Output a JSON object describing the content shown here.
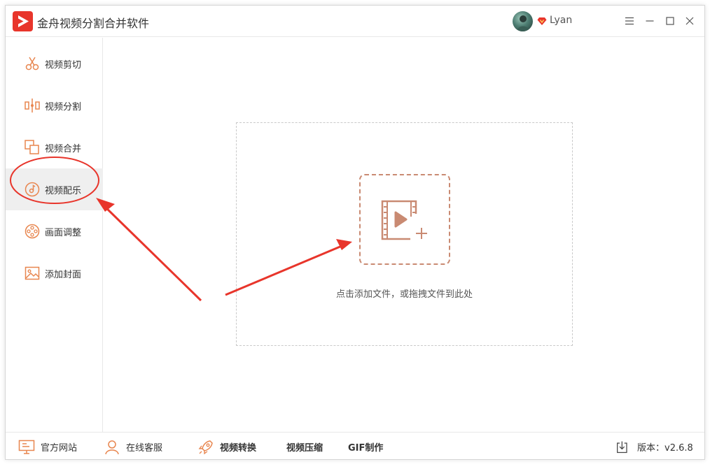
{
  "app": {
    "title": "金舟视频分割合并软件",
    "logo_icon": "play-logo-icon",
    "accent": "#e8352b"
  },
  "user": {
    "name": "Lyan",
    "vip_icon": "vip-diamond-icon"
  },
  "window_controls": {
    "menu_icon": "menu-icon",
    "minimize_icon": "minimize-icon",
    "maximize_icon": "maximize-icon",
    "close_icon": "close-icon"
  },
  "sidebar": {
    "active_index": 3,
    "items": [
      {
        "label": "视频剪切",
        "icon": "scissors-icon"
      },
      {
        "label": "视频分割",
        "icon": "split-icon"
      },
      {
        "label": "视频合并",
        "icon": "merge-icon"
      },
      {
        "label": "视频配乐",
        "icon": "music-icon"
      },
      {
        "label": "画面调整",
        "icon": "film-reel-icon"
      },
      {
        "label": "添加封面",
        "icon": "image-icon"
      }
    ]
  },
  "main": {
    "drop_hint": "点击添加文件，或拖拽文件到此处",
    "add_icon": "add-video-icon",
    "accent": "#c98a72"
  },
  "bottombar": {
    "website": {
      "label": "官方网站",
      "icon": "monitor-icon"
    },
    "support": {
      "label": "在线客服",
      "icon": "user-support-icon"
    },
    "convert": {
      "label": "视频转换",
      "icon": "rocket-icon"
    },
    "compress": {
      "label": "视频压缩"
    },
    "gif": {
      "label": "GIF制作"
    },
    "version": {
      "label": "版本：v2.6.8",
      "icon": "download-icon"
    }
  },
  "annotation_color": "#e8352b"
}
